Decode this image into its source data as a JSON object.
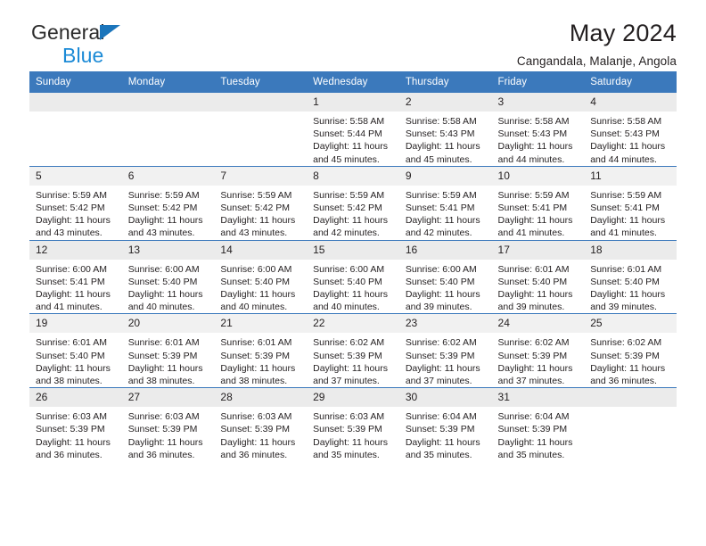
{
  "brand": {
    "name_part1": "General",
    "name_part2": "Blue",
    "accent_color": "#1b8ad6",
    "triangle_color": "#1b75bb"
  },
  "header": {
    "title": "May 2024",
    "location": "Cangandala, Malanje, Angola"
  },
  "calendar": {
    "header_bg": "#3b79bc",
    "header_text_color": "#ffffff",
    "weekdays": [
      "Sunday",
      "Monday",
      "Tuesday",
      "Wednesday",
      "Thursday",
      "Friday",
      "Saturday"
    ],
    "weeks": [
      [
        {
          "day": "",
          "sunrise": "",
          "sunset": "",
          "daylight1": "",
          "daylight2": "",
          "empty": true
        },
        {
          "day": "",
          "sunrise": "",
          "sunset": "",
          "daylight1": "",
          "daylight2": "",
          "empty": true
        },
        {
          "day": "",
          "sunrise": "",
          "sunset": "",
          "daylight1": "",
          "daylight2": "",
          "empty": true
        },
        {
          "day": "1",
          "sunrise": "Sunrise: 5:58 AM",
          "sunset": "Sunset: 5:44 PM",
          "daylight1": "Daylight: 11 hours",
          "daylight2": "and 45 minutes.",
          "empty": false
        },
        {
          "day": "2",
          "sunrise": "Sunrise: 5:58 AM",
          "sunset": "Sunset: 5:43 PM",
          "daylight1": "Daylight: 11 hours",
          "daylight2": "and 45 minutes.",
          "empty": false
        },
        {
          "day": "3",
          "sunrise": "Sunrise: 5:58 AM",
          "sunset": "Sunset: 5:43 PM",
          "daylight1": "Daylight: 11 hours",
          "daylight2": "and 44 minutes.",
          "empty": false
        },
        {
          "day": "4",
          "sunrise": "Sunrise: 5:58 AM",
          "sunset": "Sunset: 5:43 PM",
          "daylight1": "Daylight: 11 hours",
          "daylight2": "and 44 minutes.",
          "empty": false
        }
      ],
      [
        {
          "day": "5",
          "sunrise": "Sunrise: 5:59 AM",
          "sunset": "Sunset: 5:42 PM",
          "daylight1": "Daylight: 11 hours",
          "daylight2": "and 43 minutes.",
          "empty": false
        },
        {
          "day": "6",
          "sunrise": "Sunrise: 5:59 AM",
          "sunset": "Sunset: 5:42 PM",
          "daylight1": "Daylight: 11 hours",
          "daylight2": "and 43 minutes.",
          "empty": false
        },
        {
          "day": "7",
          "sunrise": "Sunrise: 5:59 AM",
          "sunset": "Sunset: 5:42 PM",
          "daylight1": "Daylight: 11 hours",
          "daylight2": "and 43 minutes.",
          "empty": false
        },
        {
          "day": "8",
          "sunrise": "Sunrise: 5:59 AM",
          "sunset": "Sunset: 5:42 PM",
          "daylight1": "Daylight: 11 hours",
          "daylight2": "and 42 minutes.",
          "empty": false
        },
        {
          "day": "9",
          "sunrise": "Sunrise: 5:59 AM",
          "sunset": "Sunset: 5:41 PM",
          "daylight1": "Daylight: 11 hours",
          "daylight2": "and 42 minutes.",
          "empty": false
        },
        {
          "day": "10",
          "sunrise": "Sunrise: 5:59 AM",
          "sunset": "Sunset: 5:41 PM",
          "daylight1": "Daylight: 11 hours",
          "daylight2": "and 41 minutes.",
          "empty": false
        },
        {
          "day": "11",
          "sunrise": "Sunrise: 5:59 AM",
          "sunset": "Sunset: 5:41 PM",
          "daylight1": "Daylight: 11 hours",
          "daylight2": "and 41 minutes.",
          "empty": false
        }
      ],
      [
        {
          "day": "12",
          "sunrise": "Sunrise: 6:00 AM",
          "sunset": "Sunset: 5:41 PM",
          "daylight1": "Daylight: 11 hours",
          "daylight2": "and 41 minutes.",
          "empty": false
        },
        {
          "day": "13",
          "sunrise": "Sunrise: 6:00 AM",
          "sunset": "Sunset: 5:40 PM",
          "daylight1": "Daylight: 11 hours",
          "daylight2": "and 40 minutes.",
          "empty": false
        },
        {
          "day": "14",
          "sunrise": "Sunrise: 6:00 AM",
          "sunset": "Sunset: 5:40 PM",
          "daylight1": "Daylight: 11 hours",
          "daylight2": "and 40 minutes.",
          "empty": false
        },
        {
          "day": "15",
          "sunrise": "Sunrise: 6:00 AM",
          "sunset": "Sunset: 5:40 PM",
          "daylight1": "Daylight: 11 hours",
          "daylight2": "and 40 minutes.",
          "empty": false
        },
        {
          "day": "16",
          "sunrise": "Sunrise: 6:00 AM",
          "sunset": "Sunset: 5:40 PM",
          "daylight1": "Daylight: 11 hours",
          "daylight2": "and 39 minutes.",
          "empty": false
        },
        {
          "day": "17",
          "sunrise": "Sunrise: 6:01 AM",
          "sunset": "Sunset: 5:40 PM",
          "daylight1": "Daylight: 11 hours",
          "daylight2": "and 39 minutes.",
          "empty": false
        },
        {
          "day": "18",
          "sunrise": "Sunrise: 6:01 AM",
          "sunset": "Sunset: 5:40 PM",
          "daylight1": "Daylight: 11 hours",
          "daylight2": "and 39 minutes.",
          "empty": false
        }
      ],
      [
        {
          "day": "19",
          "sunrise": "Sunrise: 6:01 AM",
          "sunset": "Sunset: 5:40 PM",
          "daylight1": "Daylight: 11 hours",
          "daylight2": "and 38 minutes.",
          "empty": false
        },
        {
          "day": "20",
          "sunrise": "Sunrise: 6:01 AM",
          "sunset": "Sunset: 5:39 PM",
          "daylight1": "Daylight: 11 hours",
          "daylight2": "and 38 minutes.",
          "empty": false
        },
        {
          "day": "21",
          "sunrise": "Sunrise: 6:01 AM",
          "sunset": "Sunset: 5:39 PM",
          "daylight1": "Daylight: 11 hours",
          "daylight2": "and 38 minutes.",
          "empty": false
        },
        {
          "day": "22",
          "sunrise": "Sunrise: 6:02 AM",
          "sunset": "Sunset: 5:39 PM",
          "daylight1": "Daylight: 11 hours",
          "daylight2": "and 37 minutes.",
          "empty": false
        },
        {
          "day": "23",
          "sunrise": "Sunrise: 6:02 AM",
          "sunset": "Sunset: 5:39 PM",
          "daylight1": "Daylight: 11 hours",
          "daylight2": "and 37 minutes.",
          "empty": false
        },
        {
          "day": "24",
          "sunrise": "Sunrise: 6:02 AM",
          "sunset": "Sunset: 5:39 PM",
          "daylight1": "Daylight: 11 hours",
          "daylight2": "and 37 minutes.",
          "empty": false
        },
        {
          "day": "25",
          "sunrise": "Sunrise: 6:02 AM",
          "sunset": "Sunset: 5:39 PM",
          "daylight1": "Daylight: 11 hours",
          "daylight2": "and 36 minutes.",
          "empty": false
        }
      ],
      [
        {
          "day": "26",
          "sunrise": "Sunrise: 6:03 AM",
          "sunset": "Sunset: 5:39 PM",
          "daylight1": "Daylight: 11 hours",
          "daylight2": "and 36 minutes.",
          "empty": false
        },
        {
          "day": "27",
          "sunrise": "Sunrise: 6:03 AM",
          "sunset": "Sunset: 5:39 PM",
          "daylight1": "Daylight: 11 hours",
          "daylight2": "and 36 minutes.",
          "empty": false
        },
        {
          "day": "28",
          "sunrise": "Sunrise: 6:03 AM",
          "sunset": "Sunset: 5:39 PM",
          "daylight1": "Daylight: 11 hours",
          "daylight2": "and 36 minutes.",
          "empty": false
        },
        {
          "day": "29",
          "sunrise": "Sunrise: 6:03 AM",
          "sunset": "Sunset: 5:39 PM",
          "daylight1": "Daylight: 11 hours",
          "daylight2": "and 35 minutes.",
          "empty": false
        },
        {
          "day": "30",
          "sunrise": "Sunrise: 6:04 AM",
          "sunset": "Sunset: 5:39 PM",
          "daylight1": "Daylight: 11 hours",
          "daylight2": "and 35 minutes.",
          "empty": false
        },
        {
          "day": "31",
          "sunrise": "Sunrise: 6:04 AM",
          "sunset": "Sunset: 5:39 PM",
          "daylight1": "Daylight: 11 hours",
          "daylight2": "and 35 minutes.",
          "empty": false
        },
        {
          "day": "",
          "sunrise": "",
          "sunset": "",
          "daylight1": "",
          "daylight2": "",
          "empty": true
        }
      ]
    ]
  }
}
